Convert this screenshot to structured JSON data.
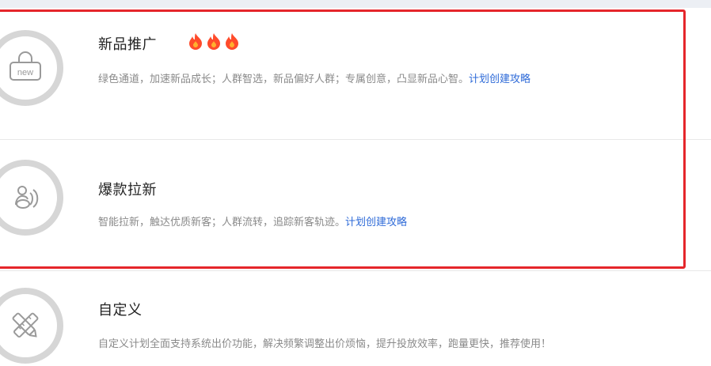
{
  "colors": {
    "link": "#2f6bd8",
    "highlight": "#e5262b",
    "fire": "#ff4b2b",
    "ring": "#d6d6d6"
  },
  "cards": [
    {
      "icon": "shopping-bag-new-icon",
      "icon_text": "new",
      "title": "新品推广",
      "fire_icons": [
        "fire-icon",
        "fire-icon",
        "fire-icon"
      ],
      "desc_text": "绿色通道，加速新品成长；人群智选，新品偏好人群；专属创意，凸显新品心智。",
      "desc_link": "计划创建攻略"
    },
    {
      "icon": "customer-growth-icon",
      "title": "爆款拉新",
      "desc_text": "智能拉新，触达优质新客；人群流转，追踪新客轨迹。",
      "desc_link": "计划创建攻略"
    },
    {
      "icon": "pencil-ruler-icon",
      "title": "自定义",
      "desc_text": "自定义计划全面支持系统出价功能，解决频繁调整出价烦恼，提升投放效率，跑量更快，推荐使用！"
    }
  ]
}
